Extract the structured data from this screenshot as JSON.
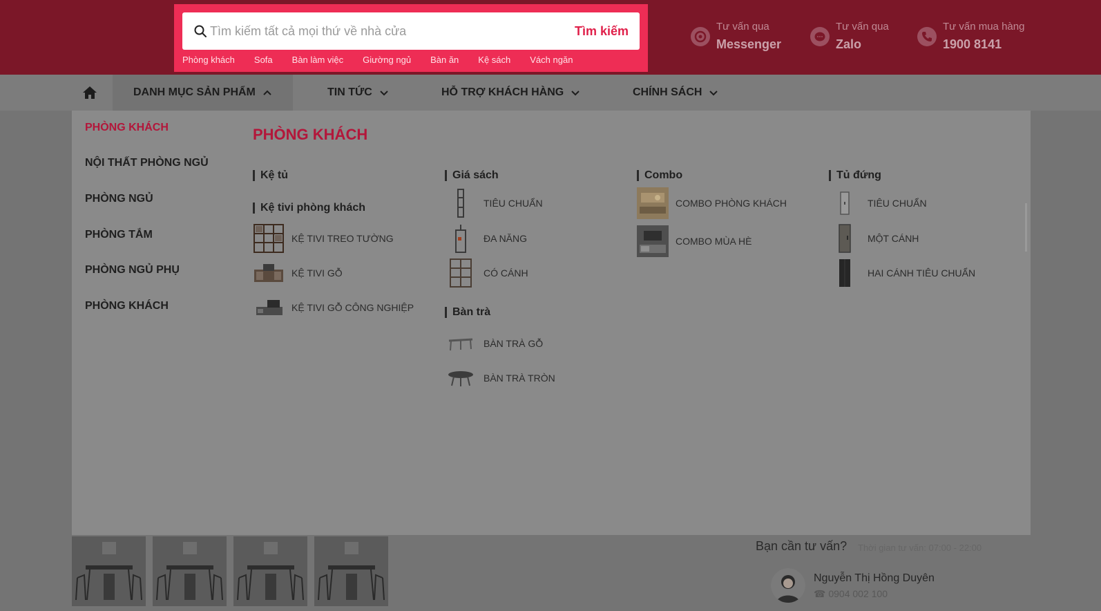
{
  "search": {
    "placeholder": "Tìm kiếm tất cả mọi thứ về nhà cửa",
    "button_label": "Tìm kiếm",
    "quick_links": [
      "Phòng khách",
      "Sofa",
      "Bàn làm việc",
      "Giường ngủ",
      "Bàn ăn",
      "Kệ sách",
      "Vách ngăn"
    ]
  },
  "contacts": [
    {
      "label": "Tư vấn qua",
      "value": "Messenger",
      "icon": "messenger-icon"
    },
    {
      "label": "Tư vấn qua",
      "value": "Zalo",
      "icon": "zalo-icon"
    },
    {
      "label": "Tư vấn mua hàng",
      "value": "1900 8141",
      "icon": "phone-icon"
    }
  ],
  "nav": {
    "items": [
      {
        "label": "DANH MỤC SẢN PHẨM"
      },
      {
        "label": "TIN TỨC"
      },
      {
        "label": "HỖ TRỢ KHÁCH HÀNG"
      },
      {
        "label": "CHÍNH SÁCH"
      }
    ]
  },
  "categories": [
    "PHÒNG KHÁCH",
    "NỘI THẤT PHÒNG NGỦ",
    "PHÒNG NGỦ",
    "PHÒNG TẮM",
    "PHÒNG NGỦ PHỤ",
    "PHÒNG KHÁCH"
  ],
  "panel": {
    "title": "PHÒNG KHÁCH",
    "groups": [
      {
        "name": "Kệ tủ",
        "items": []
      },
      {
        "name": "Kệ tivi phòng khách",
        "items": [
          "KỆ TIVI TREO TƯỜNG",
          "KỆ TIVI GỖ",
          "KỆ TIVI GỖ CÔNG NGHIỆP"
        ]
      },
      {
        "name": "Giá sách",
        "items": [
          "TIÊU CHUẨN",
          "ĐA NĂNG",
          "CÓ CÁNH"
        ]
      },
      {
        "name": "Bàn trà",
        "items": [
          "BÀN TRÀ GỖ",
          "BÀN TRÀ TRÒN"
        ]
      },
      {
        "name": "Combo",
        "items": [
          "COMBO PHÒNG KHÁCH",
          "COMBO MÙA HÈ"
        ]
      },
      {
        "name": "Tủ đứng",
        "items": [
          "TIÊU CHUẨN",
          "MỘT CÁNH",
          "HAI CÁNH TIÊU CHUẨN"
        ]
      }
    ]
  },
  "advice": {
    "title": "Bạn cần tư vấn?",
    "hours_label": "Thời gian tư vấn:",
    "hours": "07:00 - 22:00",
    "agent_name": "Nguyễn Thị Hồng Duyên",
    "agent_phone": "0904 002 100"
  },
  "colors": {
    "brand_red": "#ee2d55",
    "topbar_overlay": "#7b1728",
    "active_category": "#b3163a"
  }
}
